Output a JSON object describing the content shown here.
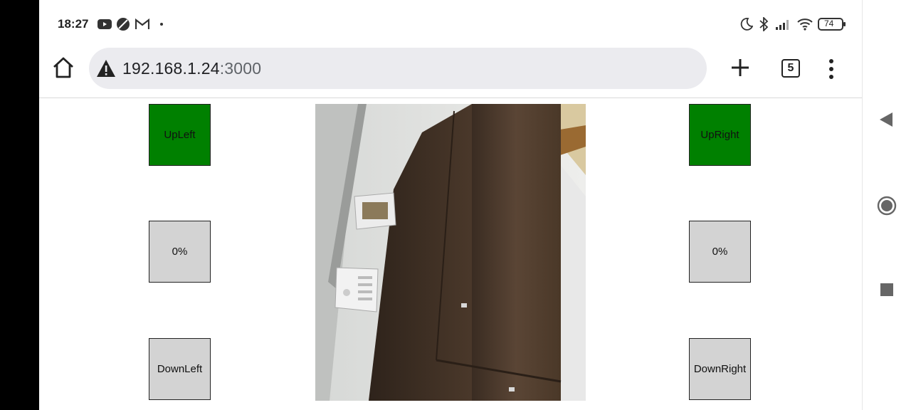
{
  "status_bar": {
    "time": "18:27",
    "battery": "74",
    "left_icons": [
      "youtube-icon",
      "app-icon",
      "gmail-icon",
      "dot-icon"
    ],
    "right_icons": [
      "moon-icon",
      "bluetooth-icon",
      "signal-icon",
      "wifi-icon",
      "battery-icon"
    ]
  },
  "browser": {
    "url_host": "192.168.1.24",
    "url_port": ":3000",
    "tab_count": "5",
    "icons": [
      "home-icon",
      "warning-icon",
      "plus-icon",
      "tabs-icon",
      "more-vert-icon"
    ]
  },
  "controls": {
    "up_left": "UpLeft",
    "up_right": "UpRight",
    "left_level": "0%",
    "right_level": "0%",
    "down_left": "DownLeft",
    "down_right": "DownRight",
    "colors": {
      "active": "#008000",
      "inactive": "#d3d3d3"
    }
  },
  "android_nav": {
    "icons": [
      "back-icon",
      "home-circle-icon",
      "recents-icon"
    ]
  }
}
